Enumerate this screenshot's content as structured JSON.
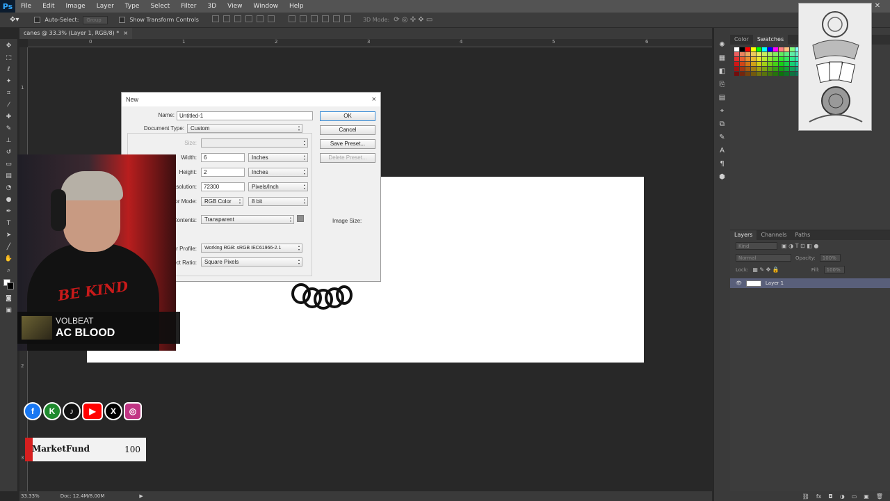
{
  "app": {
    "logo": "Ps",
    "menu": [
      "File",
      "Edit",
      "Image",
      "Layer",
      "Type",
      "Select",
      "Filter",
      "3D",
      "View",
      "Window",
      "Help"
    ],
    "window_controls": [
      "minimize",
      "maximize",
      "close"
    ]
  },
  "options_bar": {
    "auto_select_label": "Auto-Select:",
    "auto_select_value": "Group",
    "show_transform_label": "Show Transform Controls",
    "mode_3d_label": "3D Mode:"
  },
  "document": {
    "tab_title": "canes @ 33.3% (Layer 1, RGB/8) *",
    "tab_close": "×",
    "ruler_h_marks": [
      "0",
      "1",
      "2",
      "3",
      "4",
      "5",
      "6"
    ],
    "ruler_v_marks": [
      "1",
      "2",
      "3"
    ]
  },
  "status_bar": {
    "zoom": "33.33%",
    "doc_size": "Doc: 12.4M/8.00M"
  },
  "dialog": {
    "title": "New",
    "close": "×",
    "name_label": "Name:",
    "name_value": "Untitled-1",
    "doc_type_label": "Document Type:",
    "doc_type_value": "Custom",
    "size_label": "Size:",
    "size_value": "",
    "width_label": "Width:",
    "width_value": "6",
    "width_unit": "Inches",
    "height_label": "Height:",
    "height_value": "2",
    "height_unit": "Inches",
    "resolution_label": "Resolution:",
    "resolution_value": "72300",
    "resolution_unit": "Pixels/Inch",
    "color_mode_label": "Color Mode:",
    "color_mode_value": "RGB Color",
    "bit_depth_value": "8 bit",
    "bg_contents_label": "Background Contents:",
    "bg_contents_value": "Transparent",
    "color_profile_label": "Color Profile:",
    "color_profile_value": "Working RGB:  sRGB IEC61966-2.1",
    "pixel_aspect_label": "Pixel Aspect Ratio:",
    "pixel_aspect_value": "Square Pixels",
    "image_size_label": "Image Size:",
    "buttons": {
      "ok": "OK",
      "cancel": "Cancel",
      "save_preset": "Save Preset...",
      "delete_preset": "Delete Preset..."
    }
  },
  "right_panel": {
    "color_tabs": [
      "Color",
      "Swatches"
    ],
    "layer_tabs": [
      "Layers",
      "Channels",
      "Paths"
    ],
    "kind_filter": "Kind",
    "blend_mode": "Normal",
    "opacity_label": "Opacity:",
    "opacity_value": "100%",
    "lock_label": "Lock:",
    "fill_label": "Fill:",
    "fill_value": "100%",
    "layers": [
      {
        "name": "Layer 1",
        "visible": true
      }
    ]
  },
  "overlays": {
    "shirt_text": "BE KIND",
    "music_artist": "VOLBEAT",
    "music_title": "AC BLOOD",
    "socials": [
      "facebook-icon",
      "kick-icon",
      "tiktok-icon",
      "youtube-icon",
      "x-icon",
      "instagram-icon"
    ],
    "social_glyphs": {
      "facebook": "f",
      "kick": "K",
      "tiktok": "♪",
      "youtube": "▶",
      "x": "X",
      "instagram": "◎"
    },
    "marketfund_label": "MarketFund",
    "marketfund_value": "100"
  },
  "colors": {
    "ps_blue": "#31a8ff",
    "workspace": "#282828",
    "panel": "#3c3c3c",
    "selected_layer": "#595f7a",
    "dialog_bg": "#f0f0f0"
  }
}
